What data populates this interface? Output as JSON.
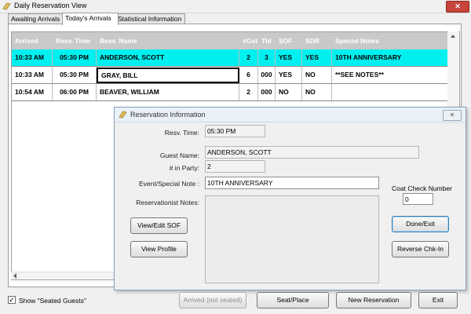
{
  "window": {
    "title": "Daily Reservation View",
    "close_label": "✕"
  },
  "tabs": [
    {
      "label": "Awaiting Arrivals",
      "active": false
    },
    {
      "label": "Today's Arrivals",
      "active": true
    },
    {
      "label": "Statistical Information",
      "active": false
    }
  ],
  "grid": {
    "columns": [
      "Arrived",
      "Resv. Time",
      "Resv. Name",
      "#Gst",
      "Tbl",
      "SOF",
      "SDR",
      "Special Notes"
    ],
    "rows": [
      {
        "cells": [
          "10:33 AM",
          "05:30 PM",
          "ANDERSON, SCOTT",
          "2",
          "3",
          "YES",
          "YES",
          "10TH ANNIVERSARY"
        ],
        "selected": true
      },
      {
        "cells": [
          "10:33 AM",
          "05:30 PM",
          "GRAY, BILL",
          "6",
          "000",
          "YES",
          "NO",
          "**SEE NOTES**"
        ],
        "selected": false
      },
      {
        "cells": [
          "10:54 AM",
          "06:00 PM",
          "BEAVER, WILLIAM",
          "2",
          "000",
          "NO",
          "NO",
          ""
        ],
        "selected": false
      }
    ]
  },
  "dialog": {
    "title": "Reservation Information",
    "close_label": "✕",
    "resv_time_label": "Resv. Time:",
    "resv_time_value": "05:30 PM",
    "guest_name_label": "Guest Name:",
    "guest_name_value": "ANDERSON, SCOTT",
    "party_label": "# in Party:",
    "party_value": "2",
    "event_label": "Event/Special Note :",
    "event_value": "10TH ANNIVERSARY",
    "notes_label": "Reservationist Notes:",
    "notes_value": "",
    "coat_check_label": "Coat Check Number",
    "coat_check_value": "0",
    "view_edit_sof": "View/Edit SOF",
    "view_profile": "View Profile",
    "done_exit": "Done/Exit",
    "reverse_chk_in": "Reverse Chk-In"
  },
  "footer": {
    "show_seated_label": "Show \"Seated Guests\"",
    "show_seated_checked": true,
    "check_mark": "✓",
    "arrived_not_seated": "Arrived (not seated)",
    "seat_place": "Seat/Place",
    "new_reservation": "New Reservation",
    "exit": "Exit"
  },
  "colors": {
    "selected_row": "#00f0f0",
    "header_bg": "#c9c9c9",
    "close_red": "#c7453b"
  }
}
